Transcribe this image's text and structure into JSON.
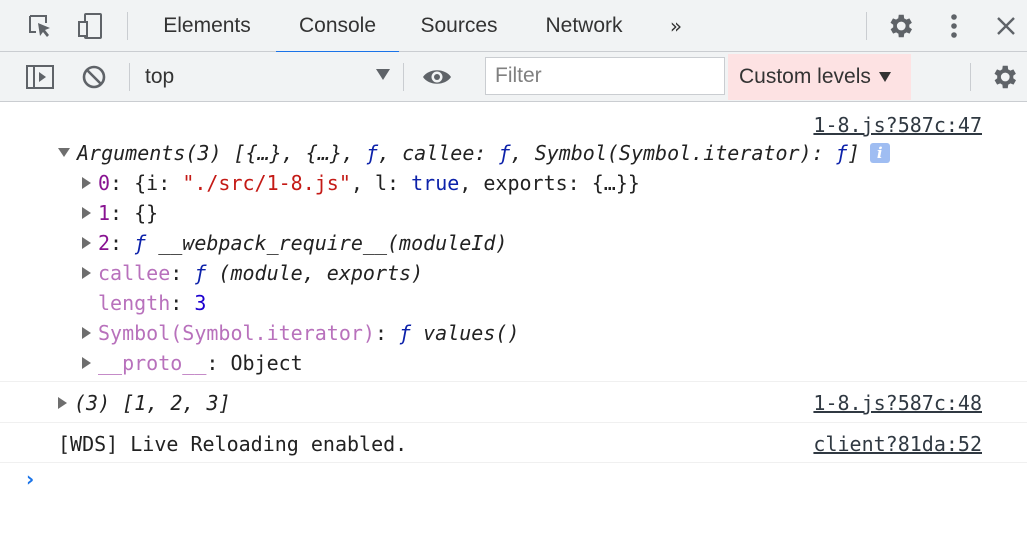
{
  "tabs": {
    "items": [
      {
        "label": "Elements"
      },
      {
        "label": "Console"
      },
      {
        "label": "Sources"
      },
      {
        "label": "Network"
      }
    ],
    "more": "»"
  },
  "toolbar": {
    "context": "top",
    "filter_placeholder": "Filter",
    "levels_label": "Custom levels"
  },
  "colors": {
    "accent": "#1a73e8",
    "levels_bg": "#fde2e3"
  },
  "console": {
    "msg1": {
      "source": "1-8.js?587c:47",
      "header": {
        "name": "Arguments(3) ",
        "preview": "[{…}, {…}, ",
        "f1": "ƒ",
        "sep1": ", ",
        "callee_key": "callee",
        "colon1": ": ",
        "f2": "ƒ",
        "sep2": ", ",
        "sym_key": "Symbol(Symbol.iterator)",
        "colon2": ": ",
        "f3": "ƒ",
        "close": "]",
        "info": "i"
      },
      "rows": {
        "r0": {
          "key": "0",
          "colon": ": ",
          "a": "{i: ",
          "b": "\"./src/1-8.js\"",
          "c": ", l: ",
          "d": "true",
          "e": ", exports: {…}}"
        },
        "r1": {
          "key": "1",
          "colon": ": ",
          "value": "{}"
        },
        "r2": {
          "key": "2",
          "colon": ": ",
          "f": "ƒ",
          "value": " __webpack_require__(moduleId)"
        },
        "r3": {
          "key": "callee",
          "colon": ": ",
          "f": "ƒ",
          "value": " (module, exports)"
        },
        "r4": {
          "key": "length",
          "colon": ": ",
          "value": "3"
        },
        "r5": {
          "key": "Symbol(Symbol.iterator)",
          "colon": ": ",
          "f": "ƒ",
          "value": " values()"
        },
        "r6": {
          "key": "__proto__",
          "colon": ": ",
          "value": "Object"
        }
      }
    },
    "msg2": {
      "source": "1-8.js?587c:48",
      "value": "(3) [1, 2, 3]"
    },
    "msg3": {
      "source": "client?81da:52",
      "value": "[WDS] Live Reloading enabled."
    },
    "prompt": "›"
  }
}
